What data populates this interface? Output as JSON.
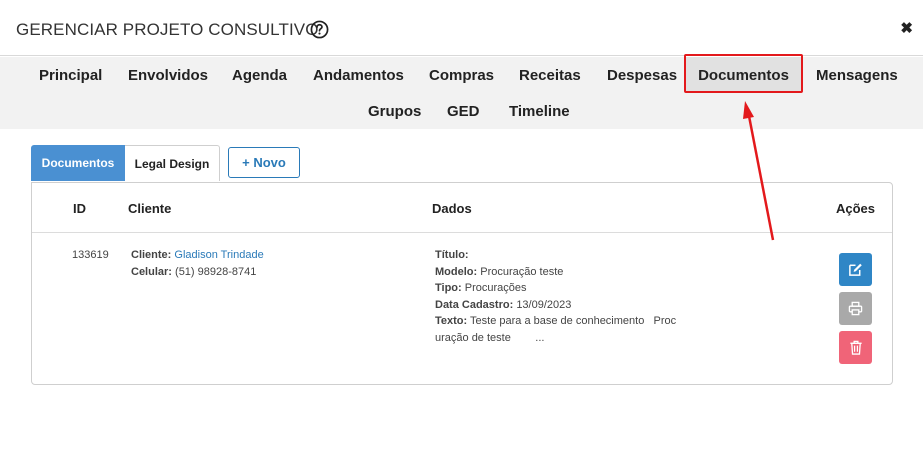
{
  "window": {
    "title": "GERENCIAR PROJETO CONSULTIVO"
  },
  "icons": {
    "help": "help-circle-icon",
    "close": "close-icon",
    "edit": "edit-icon",
    "print": "printer-icon",
    "delete": "trash-icon"
  },
  "nav": {
    "items": [
      "Principal",
      "Envolvidos",
      "Agenda",
      "Andamentos",
      "Compras",
      "Receitas",
      "Despesas",
      "Documentos",
      "Mensagens",
      "Grupos",
      "GED",
      "Timeline"
    ],
    "active": "Documentos"
  },
  "tabs": {
    "documentos": "Documentos",
    "legal_design": "Legal Design"
  },
  "buttons": {
    "novo": "+ Novo"
  },
  "table": {
    "headers": {
      "id": "ID",
      "cliente": "Cliente",
      "dados": "Dados",
      "acoes": "Ações"
    },
    "row": {
      "id": "133619",
      "cliente_label": "Cliente:",
      "cliente_value": "Gladison Trindade",
      "celular_label": "Celular:",
      "celular_value": "(51) 98928-8741",
      "titulo_label": "Título:",
      "titulo_value": "",
      "modelo_label": "Modelo:",
      "modelo_value": "Procuração teste",
      "tipo_label": "Tipo:",
      "tipo_value": "Procurações",
      "data_label": "Data Cadastro:",
      "data_value": "13/09/2023",
      "texto_label": "Texto:",
      "texto_value_line1": "Teste para a base de conhecimento   Proc",
      "texto_value_line2": "uração de teste        ..."
    }
  },
  "colors": {
    "accent_blue": "#4a90d2",
    "edit_button": "#2f86c6",
    "print_button": "#a9a9a9",
    "delete_button": "#f06478",
    "annotation_red": "#e3191c"
  }
}
